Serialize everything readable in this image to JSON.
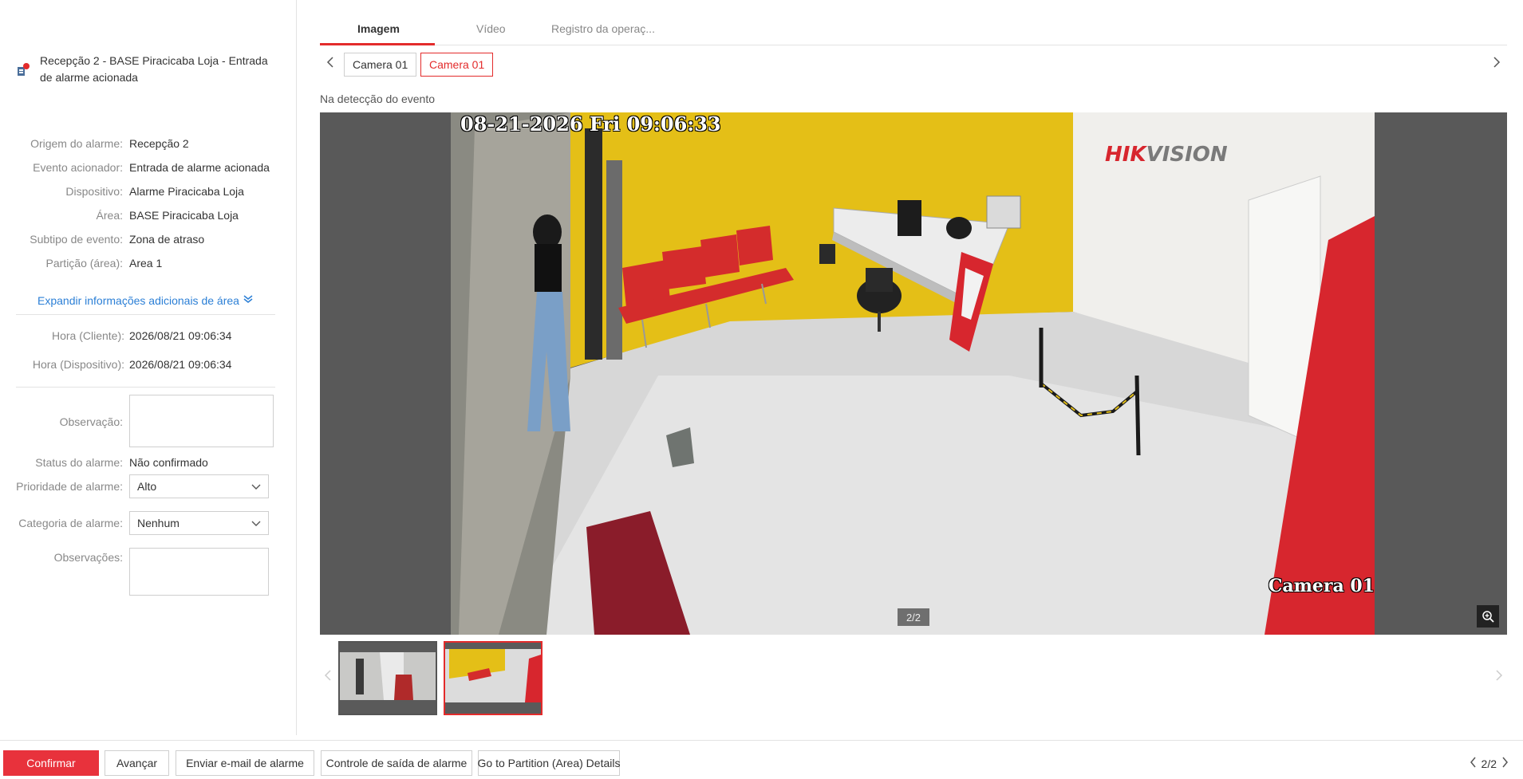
{
  "alarm": {
    "title": "Recepção 2 - BASE Piracicaba Loja - Entrada de alarme acionada"
  },
  "info": [
    {
      "label": "Origem do alarme:",
      "value": "Recepção 2"
    },
    {
      "label": "Evento acionador:",
      "value": "Entrada de alarme acionada"
    },
    {
      "label": "Dispositivo:",
      "value": "Alarme Piracicaba Loja"
    },
    {
      "label": "Área:",
      "value": "BASE Piracicaba Loja"
    },
    {
      "label": "Subtipo de evento:",
      "value": "Zona de atraso"
    },
    {
      "label": "Partição (área):",
      "value": "Area 1"
    }
  ],
  "expand_label": "Expandir informações adicionais de área",
  "times": [
    {
      "label": "Hora (Cliente):",
      "value": "2026/08/21 09:06:34"
    },
    {
      "label": "Hora (Dispositivo):",
      "value": "2026/08/21 09:06:34"
    }
  ],
  "form": {
    "observacao_label": "Observação:",
    "status_label": "Status do alarme:",
    "status_value": "Não confirmado",
    "priority_label": "Prioridade de alarme:",
    "priority_value": "Alto",
    "category_label": "Categoria de alarme:",
    "category_value": "Nenhum",
    "observacoes_label": "Observações:"
  },
  "tabs": [
    {
      "label": "Imagem",
      "active": true
    },
    {
      "label": "Vídeo",
      "active": false
    },
    {
      "label": "Registro da operaç..."
    }
  ],
  "cameras": [
    {
      "label": "Camera 01",
      "active": false
    },
    {
      "label": "Camera 01",
      "active": true
    }
  ],
  "event_label": "Na detecção do evento",
  "viewer": {
    "osd_time": "08-21-2026 Fri 09:06:33",
    "osd_brand_a": "HIK",
    "osd_brand_b": "VISION",
    "osd_camera": "Camera 01",
    "page_indicator": "2/2"
  },
  "buttons": {
    "confirm": "Confirmar",
    "next": "Avançar",
    "email": "Enviar e-mail de alarme",
    "output": "Controle de saída de alarme",
    "partition": "Go to Partition (Area) Details"
  },
  "pager": "2/2",
  "colors": {
    "accent": "#e32b2b",
    "link": "#2b7fd6",
    "wall": "#e8c21a",
    "chair": "#d7262e"
  }
}
